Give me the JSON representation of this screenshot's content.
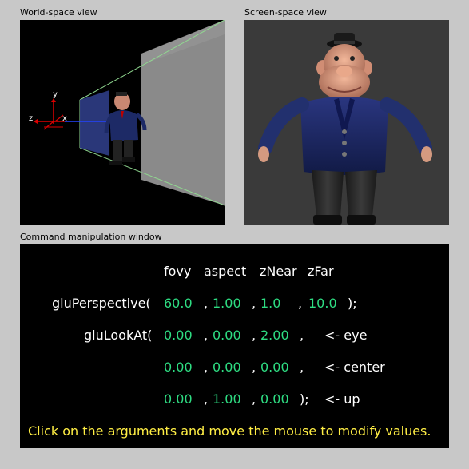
{
  "captions": {
    "world": "World-space view",
    "screen": "Screen-space view",
    "command": "Command manipulation window"
  },
  "axes": {
    "y": "y",
    "z": "z",
    "x": "x"
  },
  "command": {
    "headers": {
      "fovy": "fovy",
      "aspect": "aspect",
      "znear": "zNear",
      "zfar": "zFar"
    },
    "perspective": {
      "name": "gluPerspective(",
      "fovy": "60.0",
      "aspect": "1.00",
      "znear": "1.0",
      "zfar": "10.0",
      "sep": ",",
      "close": ");"
    },
    "lookat": {
      "name": "gluLookAt(",
      "eye": {
        "x": "0.00",
        "y": "0.00",
        "z": "2.00",
        "end": ",",
        "label": "<- eye"
      },
      "center": {
        "x": "0.00",
        "y": "0.00",
        "z": "0.00",
        "end": ",",
        "label": "<- center"
      },
      "up": {
        "x": "0.00",
        "y": "1.00",
        "z": "0.00",
        "end": ");",
        "label": "<- up"
      },
      "sep": ","
    },
    "instruction": "Click on the arguments and move the mouse to modify values."
  },
  "colors": {
    "value": "#2edc82",
    "text": "#ffffff",
    "instruction": "#ffee44",
    "frustum_lines": "#90d890",
    "axis": "#dd0000",
    "z_axis": "#2244ff"
  }
}
